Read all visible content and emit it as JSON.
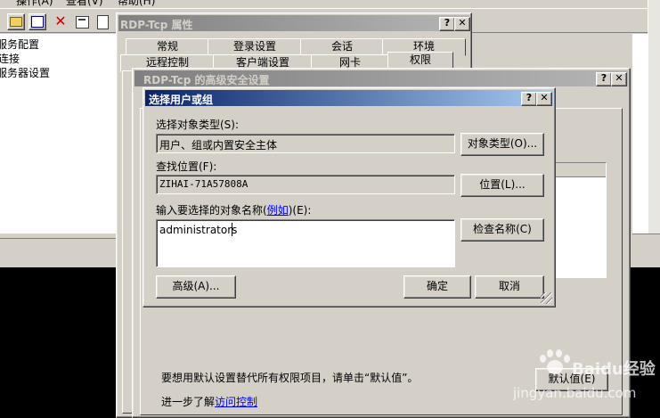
{
  "app_menu": {
    "operation": "操作(A)",
    "view": "查看(V)",
    "help": "帮助(H)"
  },
  "left_tree": {
    "items": [
      "服务配置",
      "连接",
      "服务器设置"
    ]
  },
  "properties_dialog": {
    "title": "RDP-Tcp 属性",
    "tabs_row1": [
      "常规",
      "登录设置",
      "会话",
      "环境"
    ],
    "tabs_row2": [
      "远程控制",
      "客户端设置",
      "网卡",
      "权限"
    ]
  },
  "advanced_dialog": {
    "title": "RDP-Tcp 的高级安全设置",
    "footer_text": "要想用默认设置替代所有权限项目，请单击“默认值”。",
    "more_info_prefix": "进一步了解",
    "more_info_link": "访问控制",
    "default_button": "默认值(E)"
  },
  "select_dialog": {
    "title": "选择用户或组",
    "object_type_label": "选择对象类型(S):",
    "object_type_value": "用户、组或内置安全主体",
    "object_type_button": "对象类型(O)...",
    "location_label": "查找位置(F):",
    "location_value": "ZIHAI-71A57808A",
    "location_button": "位置(L)...",
    "names_label_prefix": "输入要选择的对象名称(",
    "names_label_link": "例如",
    "names_label_suffix": ")(E):",
    "names_value": "administrators",
    "check_names_button": "检查名称(C)",
    "advanced_button": "高级(A)...",
    "ok_button": "确定",
    "cancel_button": "取消"
  },
  "watermark": {
    "brand": "Baidu经验",
    "url": "jingyan.baidu.com"
  }
}
